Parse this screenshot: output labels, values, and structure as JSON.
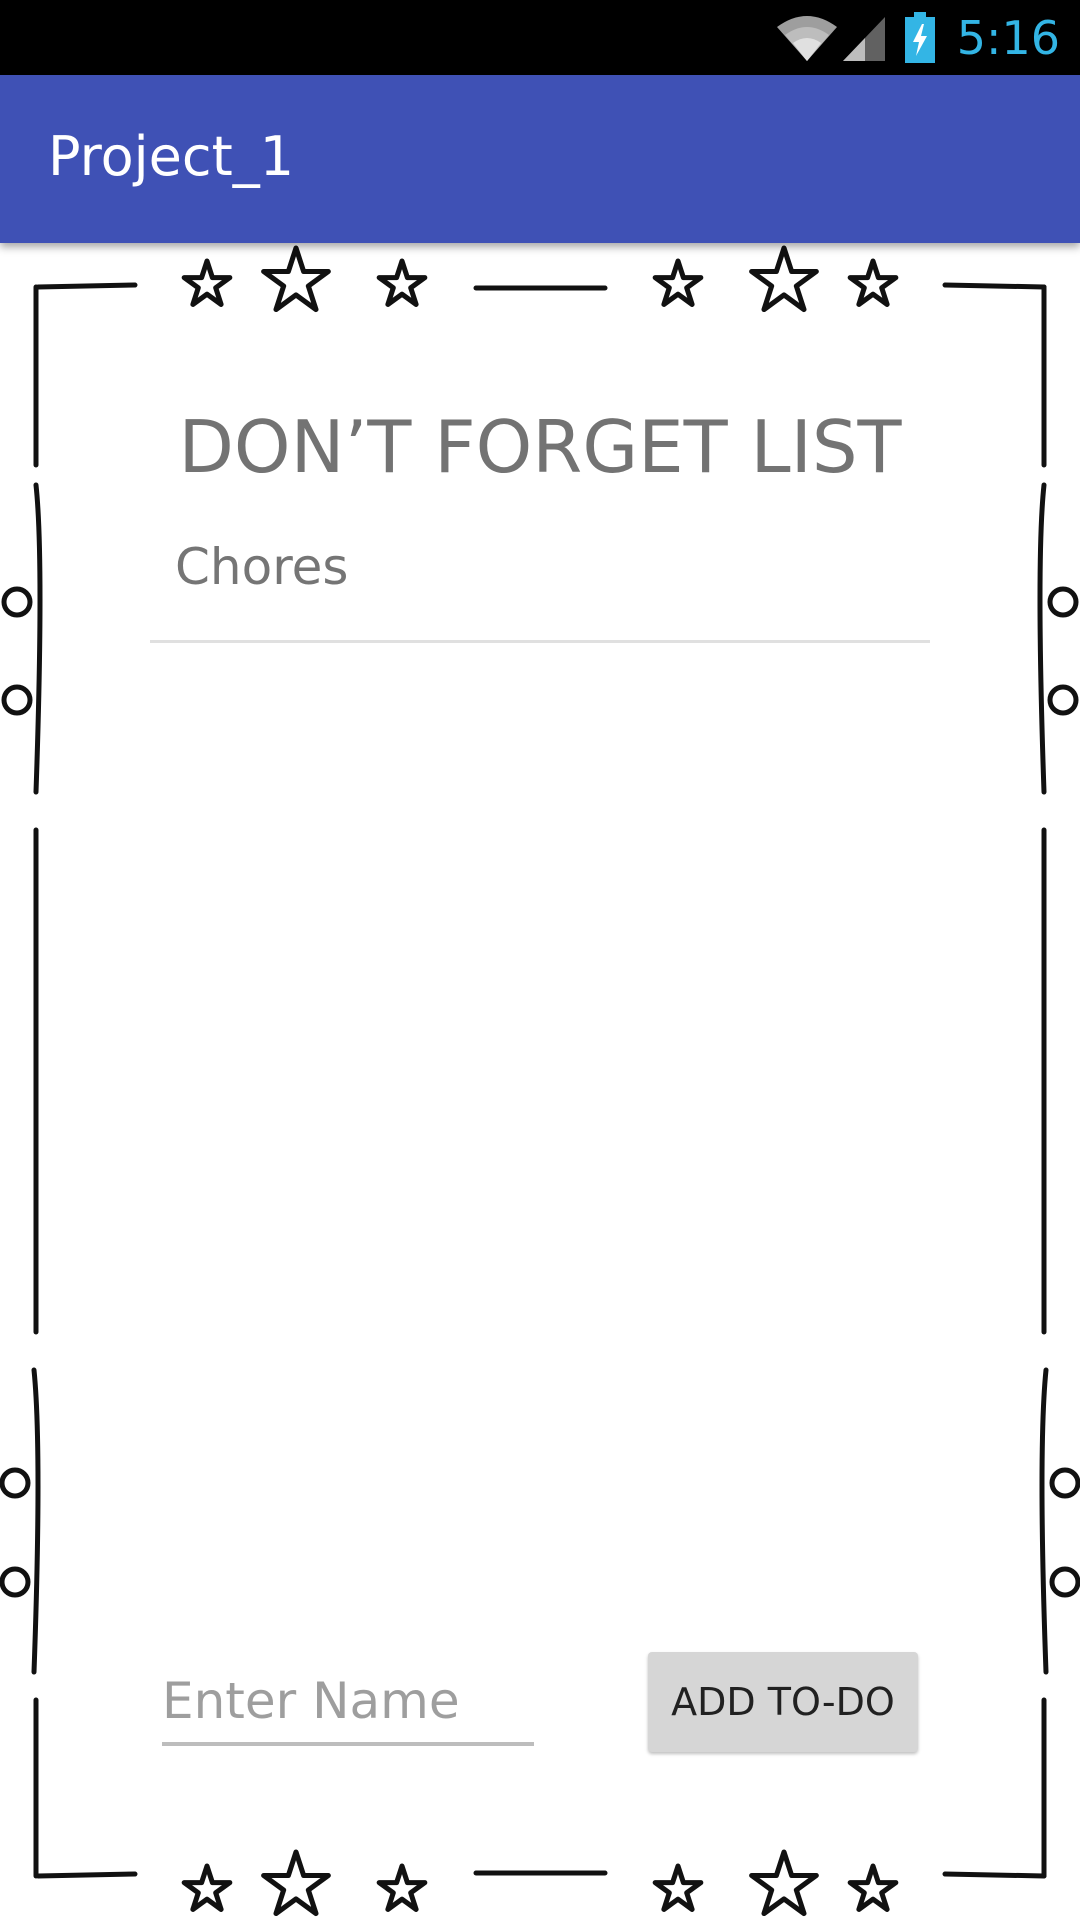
{
  "status_bar": {
    "time": "5:16",
    "time_color": "#33b5e5",
    "icons": [
      "wifi-icon",
      "cell-signal-icon",
      "battery-charging-icon"
    ]
  },
  "app_bar": {
    "title": "Project_1",
    "color": "#3f51b5"
  },
  "main": {
    "heading": "DON’T FORGET LIST",
    "list": [
      {
        "label": "Chores"
      }
    ],
    "input": {
      "placeholder": "Enter Name",
      "value": ""
    },
    "add_button_label": "ADD TO-DO"
  },
  "decoration": {
    "frame": "star-border-frame"
  }
}
